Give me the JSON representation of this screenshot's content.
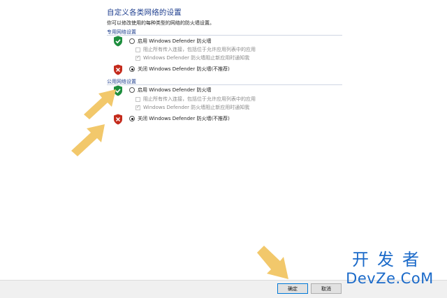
{
  "header": {
    "title": "自定义各类网络的设置",
    "description": "你可以修改使用的每种类型的网络的防火墙设置。"
  },
  "private_section": {
    "title": "专用网络设置",
    "enable_label": "启用 Windows Defender 防火墙",
    "block_all_label": "阻止所有传入连接，包括位于允许应用列表中的应用",
    "notify_label": "Windows Defender 防火墙阻止新应用时通知我",
    "disable_label": "关闭 Windows Defender 防火墙(不推荐)",
    "selected": "disable"
  },
  "public_section": {
    "title": "公用网络设置",
    "enable_label": "启用 Windows Defender 防火墙",
    "block_all_label": "阻止所有传入连接，包括位于允许应用列表中的应用",
    "notify_label": "Windows Defender 防火墙阻止新应用时通知我",
    "disable_label": "关闭 Windows Defender 防火墙(不推荐)",
    "selected": "disable"
  },
  "footer": {
    "ok_label": "确定",
    "cancel_label": "取消"
  },
  "watermark": {
    "line1": "开发者",
    "line2": "DevZe.CoM"
  },
  "colors": {
    "title_blue": "#1f3f8f",
    "shield_green": "#1e8e3e",
    "shield_red": "#c42b1c",
    "arrow_yellow": "#f2c86b",
    "watermark_blue": "#1b6ac9"
  }
}
